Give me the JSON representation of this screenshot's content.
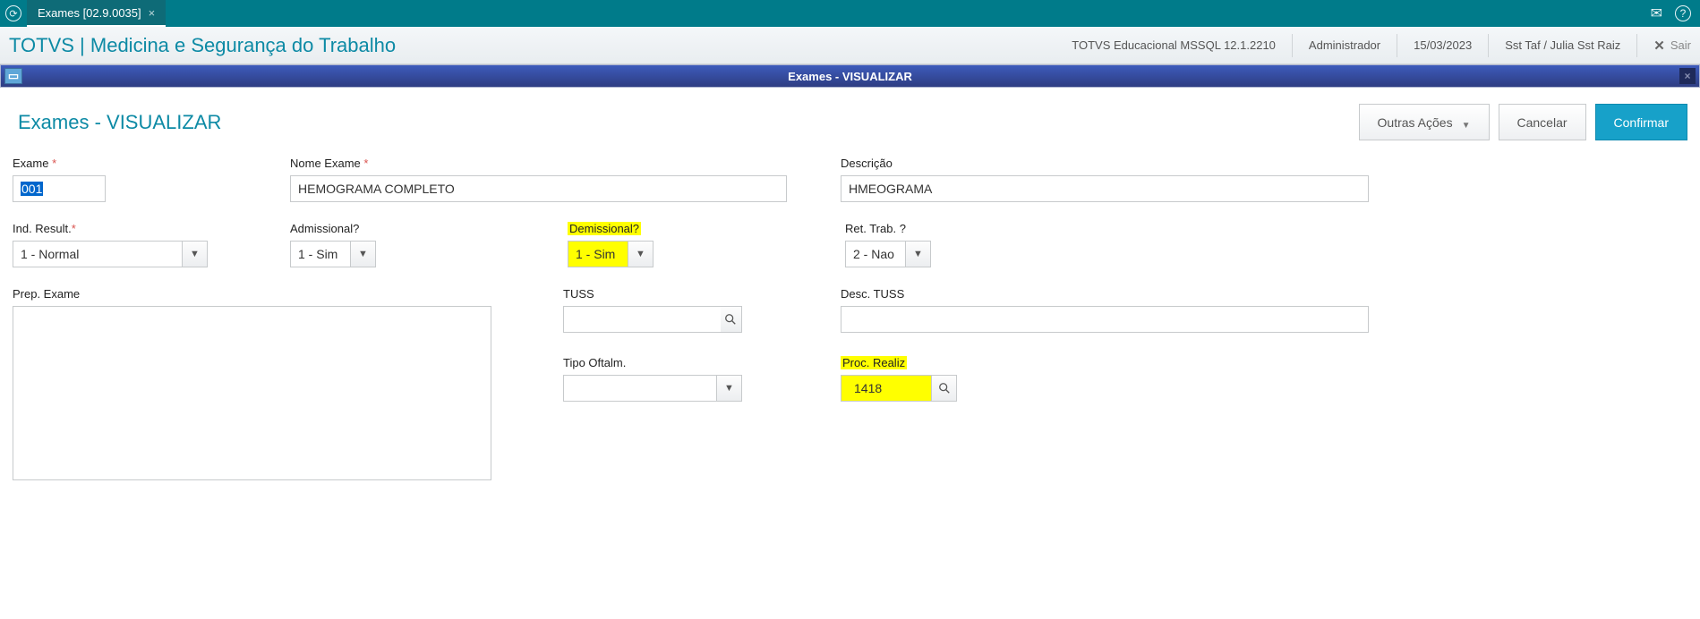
{
  "topbar": {
    "tab_label": "Exames [02.9.0035]"
  },
  "header": {
    "product_title": "TOTVS | Medicina e Segurança do Trabalho",
    "env": "TOTVS Educacional MSSQL 12.1.2210",
    "user": "Administrador",
    "date": "15/03/2023",
    "context": "Sst Taf / Julia Sst Raiz",
    "exit_label": "Sair"
  },
  "winbar": {
    "title": "Exames - VISUALIZAR"
  },
  "page": {
    "title": "Exames - VISUALIZAR",
    "actions": {
      "other": "Outras Ações",
      "cancel": "Cancelar",
      "confirm": "Confirmar"
    }
  },
  "form": {
    "exame_label": "Exame",
    "exame_value": "001",
    "nome_label": "Nome Exame",
    "nome_value": "HEMOGRAMA COMPLETO",
    "desc_label": "Descrição",
    "desc_value": "HMEOGRAMA",
    "indresult_label": "Ind. Result.",
    "indresult_value": "1 - Normal",
    "admissional_label": "Admissional?",
    "admissional_value": "1 - Sim",
    "demissional_label": "Demissional?",
    "demissional_value": "1 - Sim",
    "rettrab_label": "Ret. Trab. ?",
    "rettrab_value": "2 - Nao",
    "prep_label": "Prep. Exame",
    "prep_value": "",
    "tuss_label": "TUSS",
    "tuss_value": "",
    "desctuss_label": "Desc. TUSS",
    "desctuss_value": "",
    "tipooft_label": "Tipo Oftalm.",
    "tipooft_value": "",
    "procrealiz_label": "Proc. Realiz",
    "procrealiz_value": "1418"
  }
}
